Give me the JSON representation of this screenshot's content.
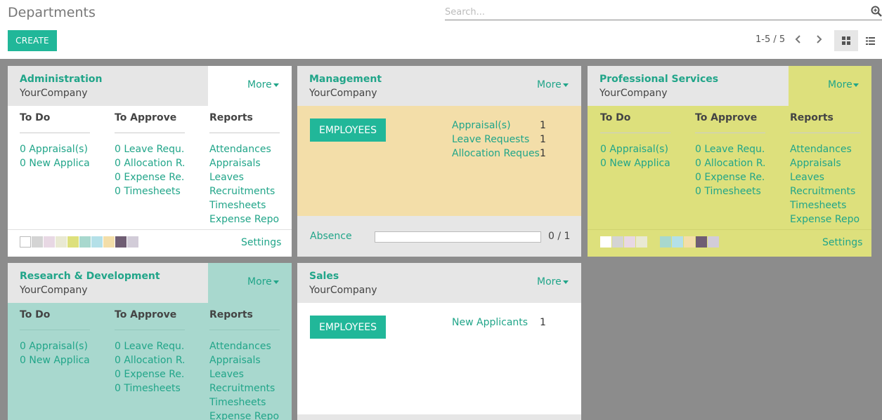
{
  "header": {
    "title": "Departments",
    "search_placeholder": "Search...",
    "create_label": "CREATE",
    "pager": "1-5 / 5"
  },
  "colors": {
    "accent": "#21b799",
    "board": "#8c8c8c"
  },
  "cards": {
    "admin": {
      "name": "Administration",
      "company": "YourCompany",
      "more": "More",
      "todo_h": "To Do",
      "approve_h": "To Approve",
      "reports_h": "Reports",
      "todo": [
        "0 Appraisal(s)",
        "0 New Applica.."
      ],
      "approve": [
        "0 Leave Requ...",
        "0 Allocation R...",
        "0 Expense Re...",
        "0 Timesheets"
      ],
      "reports": [
        "Attendances",
        "Appraisals",
        "Leaves",
        "Recruitments",
        "Timesheets",
        "Expense Repo.."
      ],
      "settings": "Settings"
    },
    "mgmt": {
      "name": "Management",
      "company": "YourCompany",
      "more": "More",
      "employees": "EMPLOYEES",
      "stats": [
        "Appraisal(s)",
        "Leave Requests",
        "Allocation Reques.."
      ],
      "counts": [
        "1",
        "1",
        "1"
      ],
      "absence": "Absence",
      "absence_value": "0 / 1",
      "absence_progress": 0
    },
    "prof": {
      "name": "Professional Services",
      "company": "YourCompany",
      "more": "More",
      "todo_h": "To Do",
      "approve_h": "To Approve",
      "reports_h": "Reports",
      "todo": [
        "0 Appraisal(s)",
        "0 New Applica.."
      ],
      "approve": [
        "0 Leave Requ...",
        "0 Allocation R...",
        "0 Expense Re...",
        "0 Timesheets"
      ],
      "reports": [
        "Attendances",
        "Appraisals",
        "Leaves",
        "Recruitments",
        "Timesheets",
        "Expense Repo.."
      ],
      "settings": "Settings"
    },
    "rnd": {
      "name": "Research & Development",
      "company": "YourCompany",
      "more": "More",
      "todo_h": "To Do",
      "approve_h": "To Approve",
      "reports_h": "Reports",
      "todo": [
        "0 Appraisal(s)",
        "0 New Applica.."
      ],
      "approve": [
        "0 Leave Requ...",
        "0 Allocation R...",
        "0 Expense Re...",
        "0 Timesheets"
      ],
      "reports": [
        "Attendances",
        "Appraisals",
        "Leaves",
        "Recruitments",
        "Timesheets",
        "Expense Repo.."
      ]
    },
    "sales": {
      "name": "Sales",
      "company": "YourCompany",
      "more": "More",
      "employees": "EMPLOYEES",
      "stats": [
        "New Applicants"
      ],
      "counts": [
        "1"
      ]
    }
  },
  "palette": [
    "#ffffff",
    "#d4d4d4",
    "#e8d8e4",
    "#e9e9d3",
    "#dde07c",
    "#a8d8ce",
    "#b4e0e8",
    "#f3dea9",
    "#6f5d73",
    "#d2ccd8"
  ]
}
